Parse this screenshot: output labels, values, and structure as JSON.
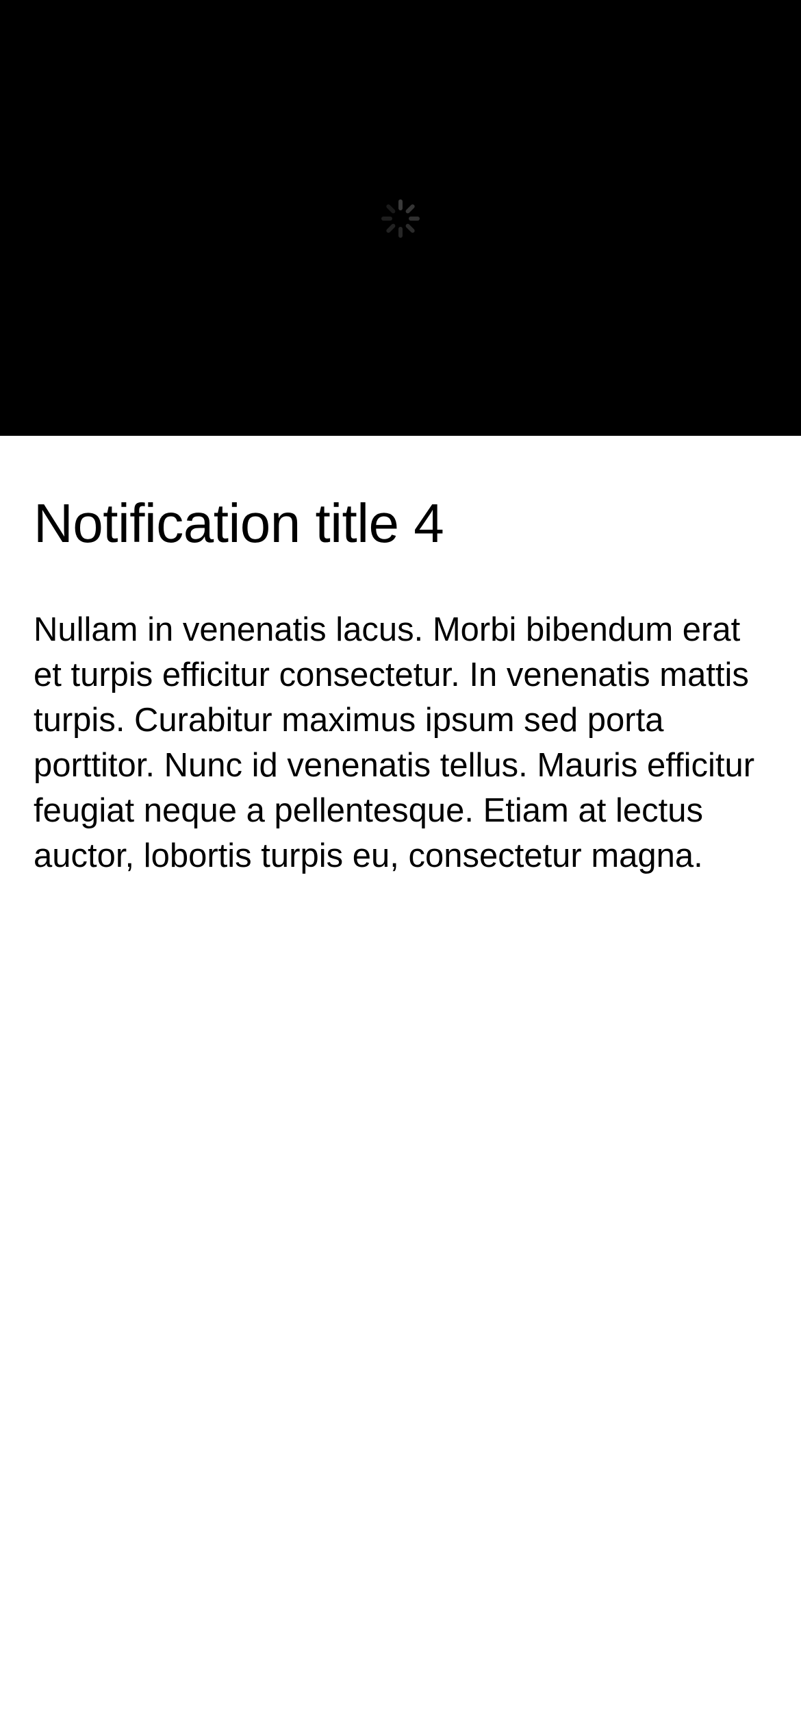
{
  "notification": {
    "media": {
      "background_color": "#000000",
      "loading_indicator": "activity-spinner-icon"
    },
    "title": "Notification title 4",
    "body": "Nullam in venenatis lacus. Morbi bibendum erat et turpis efficitur consectetur. In venenatis mattis turpis. Curabitur maximus ipsum sed porta porttitor. Nunc id venenatis tellus. Mauris efficitur feugiat neque a pellentesque. Etiam at lectus auctor, lobortis turpis eu, consectetur magna."
  }
}
